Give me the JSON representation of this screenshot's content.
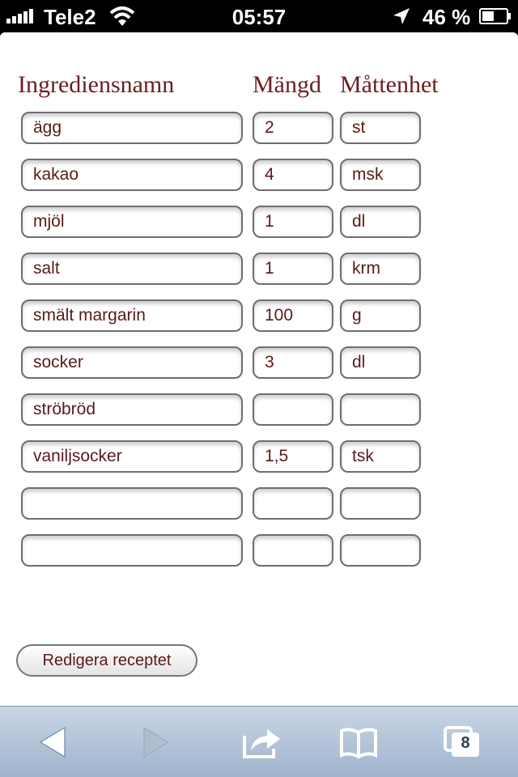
{
  "status_bar": {
    "carrier": "Tele2",
    "time": "05:57",
    "battery": "46 %"
  },
  "headers": {
    "name": "Ingrediensnamn",
    "amount": "Mängd",
    "unit": "Måttenhet"
  },
  "rows": [
    {
      "name": "ägg",
      "amount": "2",
      "unit": "st"
    },
    {
      "name": "kakao",
      "amount": "4",
      "unit": "msk"
    },
    {
      "name": "mjöl",
      "amount": "1",
      "unit": "dl"
    },
    {
      "name": "salt",
      "amount": "1",
      "unit": "krm"
    },
    {
      "name": "smält margarin",
      "amount": "100",
      "unit": "g"
    },
    {
      "name": "socker",
      "amount": "3",
      "unit": "dl"
    },
    {
      "name": "ströbröd",
      "amount": "",
      "unit": ""
    },
    {
      "name": "vaniljsocker",
      "amount": "1,5",
      "unit": "tsk"
    },
    {
      "name": "",
      "amount": "",
      "unit": ""
    },
    {
      "name": "",
      "amount": "",
      "unit": ""
    }
  ],
  "edit_button_label": "Redigera receptet",
  "toolbar": {
    "tab_count": "8",
    "icons": [
      "back-icon",
      "forward-icon",
      "share-icon",
      "bookmarks-icon",
      "tabs-icon"
    ]
  }
}
